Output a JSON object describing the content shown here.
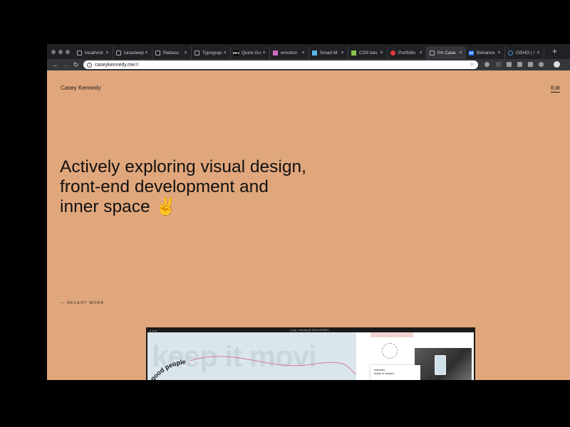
{
  "browser": {
    "tabs": [
      {
        "label": "localhost",
        "icon": "page-icon",
        "active": false
      },
      {
        "label": "lunasleep",
        "icon": "page-icon",
        "active": false
      },
      {
        "label": "Rebass",
        "icon": "page-icon",
        "active": false
      },
      {
        "label": "Typograp",
        "icon": "page-icon",
        "active": false
      },
      {
        "label": "Quick Gu",
        "icon": "dev-icon",
        "badge": "DEV",
        "active": false
      },
      {
        "label": "emotion",
        "icon": "emotion-icon",
        "active": false
      },
      {
        "label": "Smart M",
        "icon": "smart-icon",
        "active": false
      },
      {
        "label": "CSS bas",
        "icon": "css-icon",
        "active": false
      },
      {
        "label": "Portfolio",
        "icon": "portfolio-icon",
        "active": false
      },
      {
        "label": "I'm Case",
        "icon": "page-icon",
        "active": true
      },
      {
        "label": "Behance",
        "icon": "behance-icon",
        "badge": "Bē",
        "active": false
      },
      {
        "label": "OSHO | I",
        "icon": "osho-icon",
        "active": false
      }
    ],
    "address": {
      "host": "caseykennedy.me",
      "rest": "/#"
    }
  },
  "page": {
    "brand": "Casey Kennedy",
    "menu_label": "tl;dr",
    "hero_line1": "Actively exploring visual design,",
    "hero_line2": "front-end development and",
    "hero_line3": "inner space ✌️",
    "recent_label": "— RECENT WORK",
    "preview": {
      "titlebar": "1.png - new.png @ 100% (RGB/8*)",
      "big_text": "keep it movi",
      "arc_text": "good people",
      "card_line1": "matches",
      "card_line2": "made in heaven"
    }
  },
  "colors": {
    "page_background": "#e1a77c",
    "chrome_dark": "#202124",
    "toolbar": "#35363a"
  }
}
